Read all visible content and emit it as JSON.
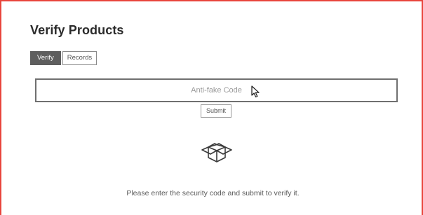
{
  "page": {
    "title": "Verify Products"
  },
  "tabs": [
    {
      "label": "Verify",
      "active": true
    },
    {
      "label": "Records",
      "active": false
    }
  ],
  "verify_form": {
    "code_input": {
      "placeholder": "Anti-fake Code",
      "value": ""
    },
    "submit_label": "Submit"
  },
  "empty_state": {
    "icon": "open-box-icon",
    "message": "Please enter the security code and submit to verify it."
  },
  "colors": {
    "frame_border": "#e8453c",
    "active_tab": "#5e5e5e"
  },
  "icons": {
    "cursor": "mouse-pointer-icon"
  }
}
